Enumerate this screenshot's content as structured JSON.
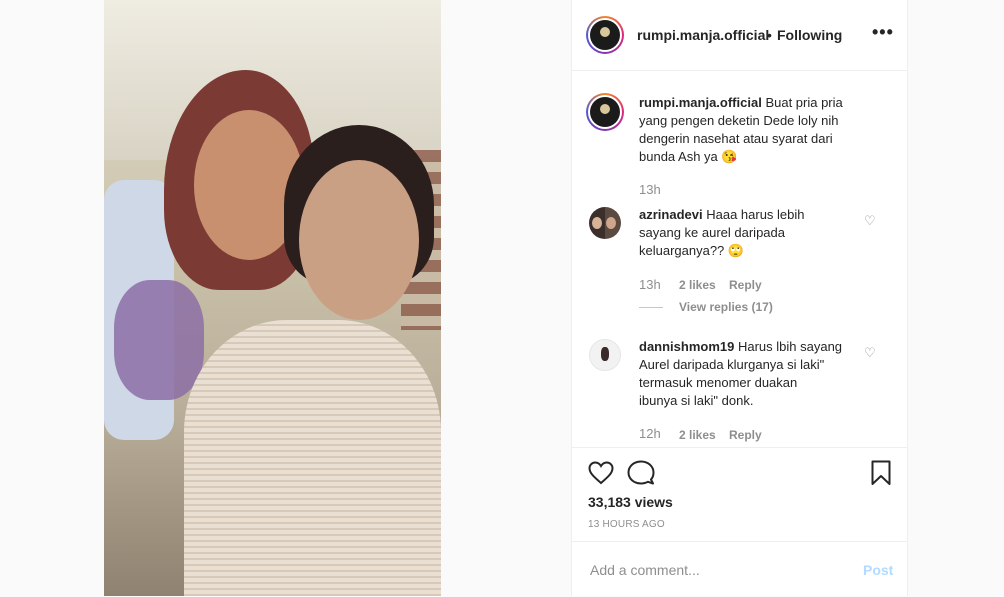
{
  "header": {
    "username": "rumpi.manja.official",
    "separator": "•",
    "follow_status": "Following",
    "more": "•••"
  },
  "caption": {
    "username": "rumpi.manja.official",
    "lines": [
      "Buat pria pria",
      "yang pengen deketin Dede loly nih",
      "dengerin nasehat atau syarat dari",
      "bunda Ash ya 😘"
    ],
    "time": "13h"
  },
  "comments": [
    {
      "username": "azrinadevi",
      "lines": [
        "Haaa harus lebih",
        "sayang ke aurel daripada",
        "keluarganya?? 🙄"
      ],
      "time": "13h",
      "likes": "2 likes",
      "reply": "Reply",
      "view_replies": "View replies (17)"
    },
    {
      "username": "dannishmom19",
      "lines": [
        "Harus lbih sayang",
        "Aurel daripada klurganya si laki\"",
        "termasuk menomer duakan",
        "ibunya si laki\" donk."
      ],
      "time": "12h",
      "likes": "2 likes",
      "reply": "Reply"
    }
  ],
  "actions": {
    "views": "33,183 views",
    "timestamp": "13 HOURS AGO"
  },
  "add_comment": {
    "placeholder": "Add a comment...",
    "post": "Post"
  },
  "colors": {
    "accent_post": "#b3dbff",
    "text": "#262626",
    "muted": "#8e8e8e"
  }
}
